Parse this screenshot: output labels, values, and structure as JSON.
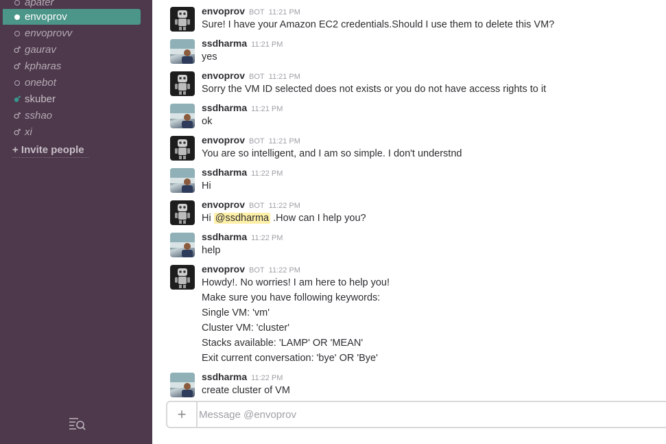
{
  "sidebar": {
    "dms": [
      {
        "label": "apater",
        "status": "away"
      },
      {
        "label": "envoprov",
        "status": "active-selected"
      },
      {
        "label": "envoprovv",
        "status": "away"
      },
      {
        "label": "gaurav",
        "status": "away-male"
      },
      {
        "label": "kpharas",
        "status": "away-male"
      },
      {
        "label": "onebot",
        "status": "away"
      },
      {
        "label": "skuber",
        "status": "online"
      },
      {
        "label": "sshao",
        "status": "away-male"
      },
      {
        "label": "xi",
        "status": "away-male"
      }
    ],
    "invite_label": "+ Invite people"
  },
  "messages": [
    {
      "author": "envoprov",
      "bot": "BOT",
      "time": "11:21 PM",
      "lines": [
        "Sure! I have your Amazon EC2 credentials.Should I use them to delete this VM?"
      ]
    },
    {
      "author": "ssdharma",
      "time": "11:21 PM",
      "lines": [
        "yes"
      ]
    },
    {
      "author": "envoprov",
      "bot": "BOT",
      "time": "11:21 PM",
      "lines": [
        "Sorry the VM ID selected does not exists or you do not have access rights to it"
      ]
    },
    {
      "author": "ssdharma",
      "time": "11:21 PM",
      "lines": [
        "ok"
      ]
    },
    {
      "author": "envoprov",
      "bot": "BOT",
      "time": "11:21 PM",
      "lines": [
        "You are so intelligent, and I am so simple. I don't understnd"
      ]
    },
    {
      "author": "ssdharma",
      "time": "11:22 PM",
      "lines": [
        "Hi"
      ]
    },
    {
      "author": "envoprov",
      "bot": "BOT",
      "time": "11:22 PM",
      "pre": "Hi ",
      "mention": "@ssdharma",
      "post": " .How can I help you?"
    },
    {
      "author": "ssdharma",
      "time": "11:22 PM",
      "lines": [
        "help"
      ]
    },
    {
      "author": "envoprov",
      "bot": "BOT",
      "time": "11:22 PM",
      "lines": [
        "Howdy!. No worries! I am here to help you!",
        "Make sure you have following keywords:",
        "Single VM: 'vm'",
        "Cluster VM: 'cluster'",
        "Stacks available: 'LAMP' OR 'MEAN'",
        "Exit current conversation: 'bye' OR 'Bye'"
      ]
    },
    {
      "author": "ssdharma",
      "time": "11:22 PM",
      "lines": [
        "create cluster of VM"
      ]
    }
  ],
  "composer": {
    "plus": "+",
    "placeholder": "Message @envoprov"
  },
  "colors": {
    "sidebar": "#4d394b",
    "active": "#4c9689",
    "mention_bg": "#fff0a8"
  }
}
